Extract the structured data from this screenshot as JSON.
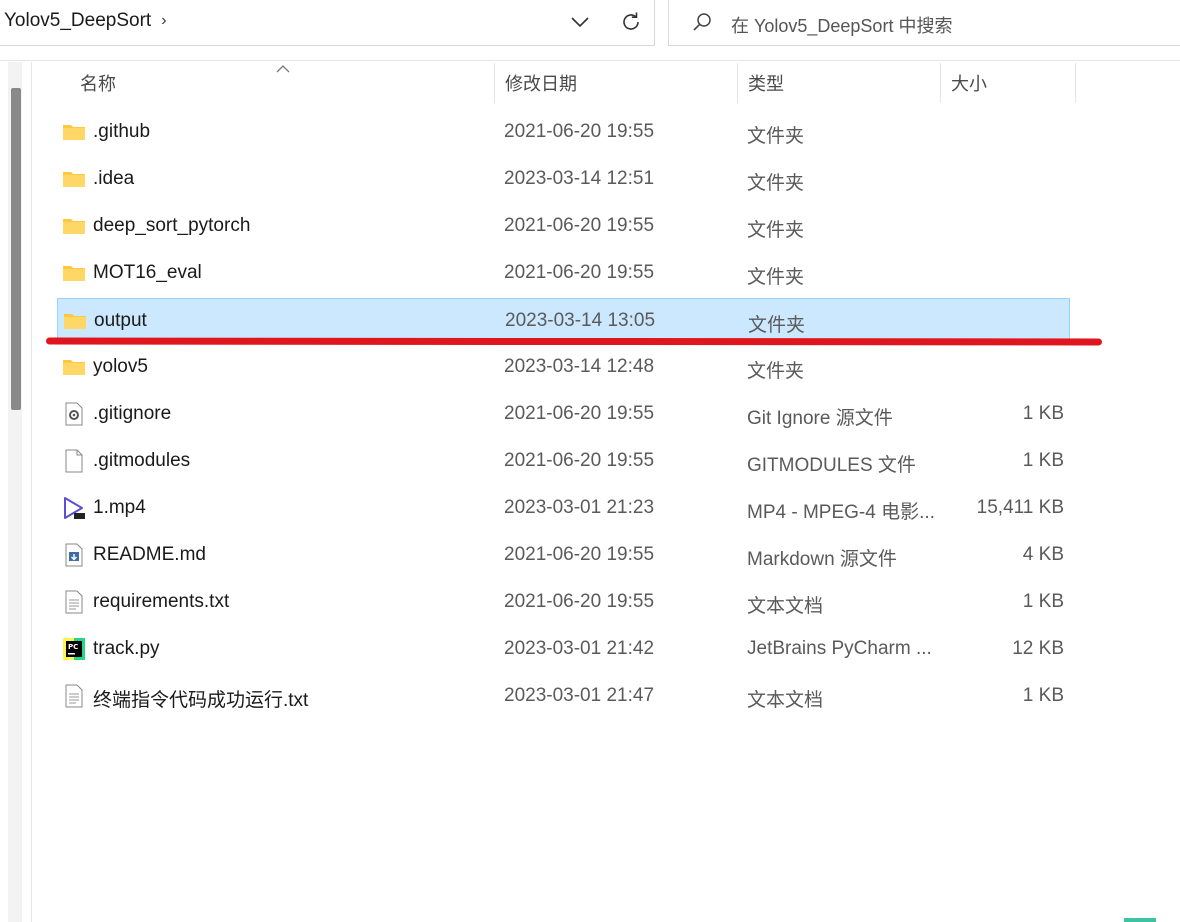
{
  "address": {
    "breadcrumb": "Yolov5_DeepSort",
    "breadcrumb_separator": "›"
  },
  "search": {
    "placeholder": "在 Yolov5_DeepSort 中搜索"
  },
  "columns": {
    "name": "名称",
    "date": "修改日期",
    "type": "类型",
    "size": "大小"
  },
  "files": [
    {
      "name": ".github",
      "date": "2021-06-20 19:55",
      "type": "文件夹",
      "size": "",
      "icon": "folder-icon"
    },
    {
      "name": ".idea",
      "date": "2023-03-14 12:51",
      "type": "文件夹",
      "size": "",
      "icon": "folder-icon"
    },
    {
      "name": "deep_sort_pytorch",
      "date": "2021-06-20 19:55",
      "type": "文件夹",
      "size": "",
      "icon": "folder-icon"
    },
    {
      "name": "MOT16_eval",
      "date": "2021-06-20 19:55",
      "type": "文件夹",
      "size": "",
      "icon": "folder-icon"
    },
    {
      "name": "output",
      "date": "2023-03-14 13:05",
      "type": "文件夹",
      "size": "",
      "icon": "folder-icon",
      "selected": true
    },
    {
      "name": "yolov5",
      "date": "2023-03-14 12:48",
      "type": "文件夹",
      "size": "",
      "icon": "folder-icon"
    },
    {
      "name": ".gitignore",
      "date": "2021-06-20 19:55",
      "type": "Git Ignore 源文件",
      "size": "1 KB",
      "icon": "gear-file-icon"
    },
    {
      "name": ".gitmodules",
      "date": "2021-06-20 19:55",
      "type": "GITMODULES 文件",
      "size": "1 KB",
      "icon": "blank-file-icon"
    },
    {
      "name": "1.mp4",
      "date": "2023-03-01 21:23",
      "type": "MP4 - MPEG-4 电影...",
      "size": "15,411 KB",
      "icon": "video-file-icon"
    },
    {
      "name": "README.md",
      "date": "2021-06-20 19:55",
      "type": "Markdown 源文件",
      "size": "4 KB",
      "icon": "markdown-file-icon"
    },
    {
      "name": "requirements.txt",
      "date": "2021-06-20 19:55",
      "type": "文本文档",
      "size": "1 KB",
      "icon": "text-file-icon"
    },
    {
      "name": "track.py",
      "date": "2023-03-01 21:42",
      "type": "JetBrains PyCharm ...",
      "size": "12 KB",
      "icon": "pycharm-file-icon"
    },
    {
      "name": "终端指令代码成功运行.txt",
      "date": "2023-03-01 21:47",
      "type": "文本文档",
      "size": "1 KB",
      "icon": "text-file-icon"
    }
  ],
  "colors": {
    "selected_row": "#cce8ff",
    "annotation": "#e0161e",
    "folder": "#ffc83d"
  }
}
